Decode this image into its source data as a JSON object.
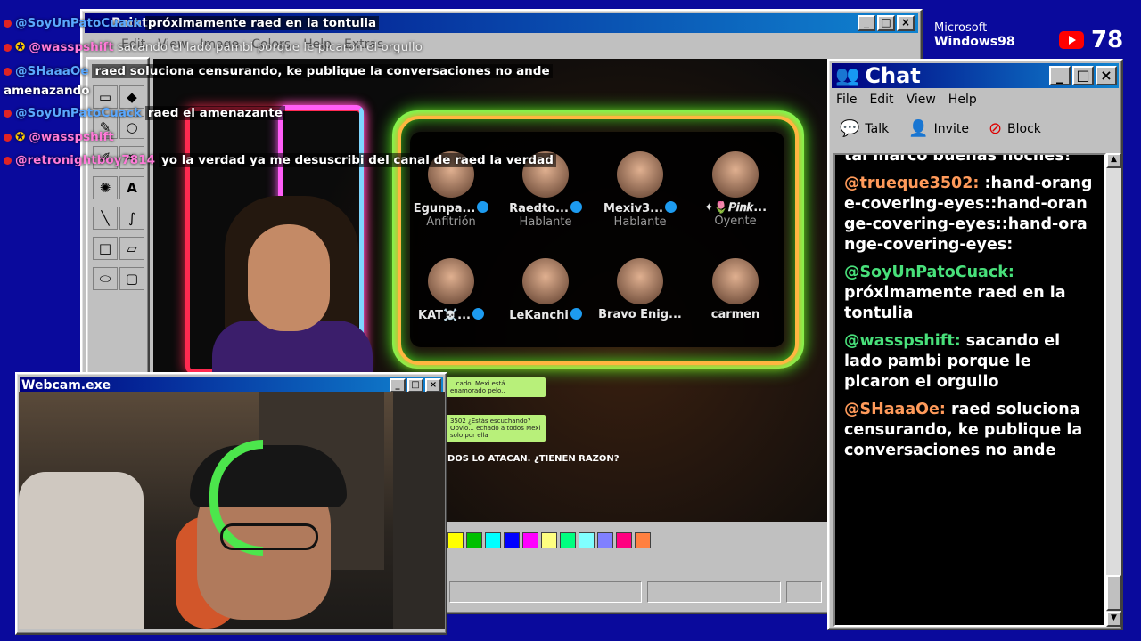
{
  "paint": {
    "title": "Paint",
    "menu": [
      "Edit",
      "View",
      "Image",
      "Colors",
      "Help",
      "Extras"
    ],
    "palette": [
      "#ffff00",
      "#00c000",
      "#00ffff",
      "#0000ff",
      "#ff00ff",
      "#ffff80",
      "#00ff80",
      "#80ffff",
      "#8080ff",
      "#ff0080",
      "#ff8040"
    ]
  },
  "overlay_chat": [
    {
      "user": "@SoyUnPatoCuack",
      "message": "próximamente raed en la tontulia"
    },
    {
      "user": "@wasspshift",
      "message": "sacando el lado pambi porque le picaron el orgullo"
    },
    {
      "user": "@SHaaaOe",
      "message": "raed soluciona censurando, ke publique la conversaciones no ande"
    },
    {
      "user": "",
      "message": "amenazando"
    },
    {
      "user": "@SoyUnPatoCuack",
      "message": "raed el amenazante"
    },
    {
      "user": "@wasspshift",
      "message": ""
    },
    {
      "user": "@retronightboy7814",
      "message": "yo la verdad ya me desuscribi del canal de raed la verdad"
    }
  ],
  "space": {
    "speakers": [
      {
        "name": "Egunpa...",
        "role": "Anfitrión",
        "verified": true
      },
      {
        "name": "Raedto...",
        "role": "Hablante",
        "verified": true
      },
      {
        "name": "Mexiv3...",
        "role": "Hablante",
        "verified": true
      },
      {
        "name": "✦🌷𝑷𝒊𝒏𝒌...",
        "role": "Oyente",
        "verified": false
      },
      {
        "name": "KAT☠️...",
        "role": "",
        "verified": true
      },
      {
        "name": "LeKanchi",
        "role": "",
        "verified": true
      },
      {
        "name": "Bravo Enig...",
        "role": "",
        "verified": false
      },
      {
        "name": "carmen",
        "role": "",
        "verified": false
      }
    ],
    "bubble1": "...cado, Mexi está enamorado pelo..",
    "bubble2": "3502 ¿Estás escuchando? Obvio... echado a todos Mexi solo por ella",
    "caption": "DOS LO ATACAN. ¿TIENEN RAZON?"
  },
  "webcam": {
    "title": "Webcam.exe"
  },
  "chat": {
    "title": "Chat",
    "menu": [
      "File",
      "Edit",
      "View",
      "Help"
    ],
    "tools": [
      "Talk",
      "Invite",
      "Block"
    ],
    "messages": [
      {
        "user": "",
        "text": "tal marco buenas noches!",
        "color": "white"
      },
      {
        "user": "@trueque3502:",
        "text": ":hand-orange-covering-eyes::hand-orange-covering-eyes::hand-orange-covering-eyes:",
        "color": "orange"
      },
      {
        "user": "@SoyUnPatoCuack:",
        "text": "próximamente raed en la tontulia",
        "color": "green"
      },
      {
        "user": "@wasspshift:",
        "text": "sacando el lado pambi porque le picaron el orgullo",
        "color": "green"
      },
      {
        "user": "@SHaaaOe:",
        "text": "raed soluciona censurando, ke publique la conversaciones no ande",
        "color": "orange"
      }
    ]
  },
  "badges": {
    "microsoft": "Microsoft",
    "windows": "Windows98",
    "viewer_count": "78"
  }
}
